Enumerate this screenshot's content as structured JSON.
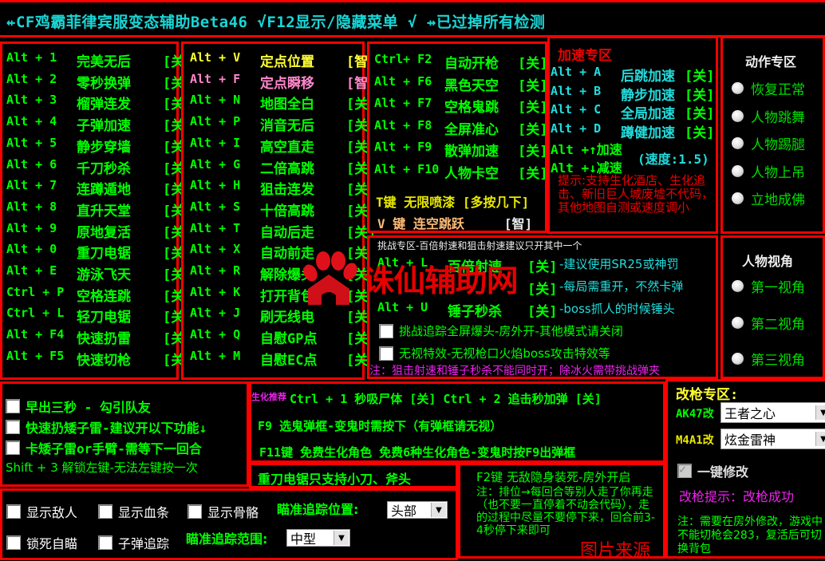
{
  "title": "⇷CF鸡霸菲律宾服变态辅助Beta46 √F12显示/隐藏菜单 √ ⇸已过掉所有检测",
  "col1": [
    {
      "key": "Alt + 1",
      "label": "完美无后",
      "state": "[关]"
    },
    {
      "key": "Alt + 2",
      "label": "零秒换弹",
      "state": "[关]"
    },
    {
      "key": "Alt + 3",
      "label": "榴弹连发",
      "state": "[关]"
    },
    {
      "key": "Alt + 4",
      "label": "子弹加速",
      "state": "[关]"
    },
    {
      "key": "Alt + 5",
      "label": "静步穿墙",
      "state": "[关]"
    },
    {
      "key": "Alt + 6",
      "label": "千刀秒杀",
      "state": "[关]"
    },
    {
      "key": "Alt + 7",
      "label": "连蹲遁地",
      "state": "[关]"
    },
    {
      "key": "Alt + 8",
      "label": "直升天堂",
      "state": "[关]"
    },
    {
      "key": "Alt + 9",
      "label": "原地复活",
      "state": "[关]"
    },
    {
      "key": "Alt + 0",
      "label": "重刀电锯",
      "state": "[关]"
    },
    {
      "key": "Alt + E",
      "label": "游泳飞天",
      "state": "[关]"
    },
    {
      "key": "Ctrl + P",
      "label": "空格连跳",
      "state": "[关]"
    },
    {
      "key": "Ctrl + L",
      "label": "轻刀电锯",
      "state": "[关]"
    },
    {
      "key": "Alt + F4",
      "label": "快速扔雷",
      "state": "[关]"
    },
    {
      "key": "Alt + F5",
      "label": "快速切枪",
      "state": "[关]"
    }
  ],
  "col2": [
    {
      "key": "Alt + V",
      "label": "定点位置",
      "state": "[智]",
      "color": "yellow"
    },
    {
      "key": "Alt + F",
      "label": "定点瞬移",
      "state": "[智]",
      "color": "pink"
    },
    {
      "key": "Alt + N",
      "label": "地图全白",
      "state": "[关]"
    },
    {
      "key": "Alt + P",
      "label": "消音无后",
      "state": "[关]"
    },
    {
      "key": "Alt + I",
      "label": "高空直走",
      "state": "[关]"
    },
    {
      "key": "Alt + G",
      "label": "二倍高跳",
      "state": "[关]"
    },
    {
      "key": "Alt + H",
      "label": "狙击连发",
      "state": "[关]"
    },
    {
      "key": "Alt + S",
      "label": "十倍高跳",
      "state": "[关]"
    },
    {
      "key": "Alt + T",
      "label": "自动后走",
      "state": "[关]"
    },
    {
      "key": "Alt + X",
      "label": "自动前走",
      "state": "[关]"
    },
    {
      "key": "Alt + R",
      "label": "解除爆头",
      "state": "[关]"
    },
    {
      "key": "Alt + K",
      "label": "打开背包",
      "state": "[关]"
    },
    {
      "key": "Alt + J",
      "label": "刷无线电",
      "state": "[关]"
    },
    {
      "key": "Alt + Q",
      "label": "自慰GP点",
      "state": "[关]"
    },
    {
      "key": "Alt + M",
      "label": "自慰EC点",
      "state": "[关]"
    }
  ],
  "col3": {
    "rows": [
      {
        "key": "Ctrl+ F2",
        "label": "自动开枪",
        "state": "[关]"
      },
      {
        "key": "Alt + F6",
        "label": "黑色天空",
        "state": "[关]"
      },
      {
        "key": "Alt + F7",
        "label": "空格鬼跳",
        "state": "[关]"
      },
      {
        "key": "Alt + F8",
        "label": "全屏准心",
        "state": "[关]"
      },
      {
        "key": "Alt + F9",
        "label": "散弹加速",
        "state": "[关]"
      },
      {
        "key": "Alt + F10",
        "label": "人物卡空",
        "state": "[关]"
      }
    ],
    "t_key": "T键 无限喷漆 [多按几下]",
    "v_key": "V 键 连空跳跃",
    "v_state": "[智]"
  },
  "speed": {
    "title": "加速专区",
    "rows": [
      {
        "key": "Alt + A",
        "label": "后跳加速",
        "state": "[关]"
      },
      {
        "key": "Alt + B",
        "label": "静步加速",
        "state": "[关]"
      },
      {
        "key": "Alt + C",
        "label": "全局加速",
        "state": "[关]"
      },
      {
        "key": "Alt + D",
        "label": "蹲健加速",
        "state": "[关]"
      }
    ],
    "up": "Alt +↑加速",
    "down": "Alt +↓减速",
    "speed_value": "(速度:1.5)",
    "tip": "提示:支持生化酒店、生化追击、新旧巨人城废墟不代码，其他地图自测或速度调小"
  },
  "action": {
    "title": "动作专区",
    "options": [
      "恢复正常",
      "人物跳舞",
      "人物踢腿",
      "人物上吊",
      "立地成佛"
    ]
  },
  "view": {
    "title": "人物视角",
    "options": [
      "第一视角",
      "第二视角",
      "第三视角"
    ]
  },
  "challenge": {
    "header": "挑战专区-百倍射速和狙击射速建议只开其中一个",
    "rows": [
      {
        "key": "Alt + L",
        "label": "百倍射速",
        "state": "[关]",
        "hint": "-建议使用SR25或神罚"
      },
      {
        "key": "",
        "label": "",
        "state": "[关]",
        "hint": "-每局需重开，不然卡弹"
      },
      {
        "key": "Alt + U",
        "label": "锤子秒杀",
        "state": "[关]",
        "hint": "-boss抓人的时候锤头"
      }
    ],
    "checks": [
      "挑战追踪全屏爆头-房外开-其他模式请关闭",
      "无视特效-无视枪口火焰boss攻击特效等"
    ],
    "note": "注：狙击射速和锤子秒杀不能同时开；除冰火需带挑战弹夹"
  },
  "misc_left": {
    "checks": [
      "早出三秒 - 勾引队友",
      "快速扔矮子雷-建议开以下功能↓",
      "卡矮子雷or手臂-需等下一回合"
    ],
    "shift": "Shift + 3 解锁左键-无法左键按一次"
  },
  "bio": {
    "tag": "生化推荐",
    "line1": "Ctrl + 1 秒吸尸体 [关] Ctrl + 2 追击秒加弹 [关]",
    "line2": "F9 选鬼弹框-变鬼时需按下（有弹框请无视）",
    "line3": "F11键 免费生化角色 免费6种生化角色-变鬼时按F9出弹框"
  },
  "knife_note": "重刀电锯只支持小刀、斧头",
  "f2": {
    "line1": "F2键 无敌隐身装死-房外开启",
    "note": "注：排位→每回合等别人走了你再走（也不要一直停着不动会代码），走的过程中尽量不要停下来，回合前3-4秒停下来即可"
  },
  "bottom": {
    "checks_row1": [
      "显示敌人",
      "显示血条",
      "显示骨骼"
    ],
    "aim_pos_label": "瞄准追踪位置:",
    "aim_pos_value": "头部",
    "checks_row2": [
      "锁死自瞄",
      "子弹追踪"
    ],
    "aim_range_label": "瞄准追踪范围:",
    "aim_range_value": "中型"
  },
  "gun": {
    "title": "改枪专区:",
    "ak_label": "AK47改",
    "ak_value": "王者之心",
    "m4_label": "M4A1改",
    "m4_value": "炫金雷神",
    "one_key": "一键修改",
    "tip": "改枪提示：改枪成功",
    "note": "注：需要在房外修改，游戏中不能切枪会283，复活后可切换背包"
  },
  "watermark": "诛仙辅助网",
  "source_fragment": "图片来源"
}
